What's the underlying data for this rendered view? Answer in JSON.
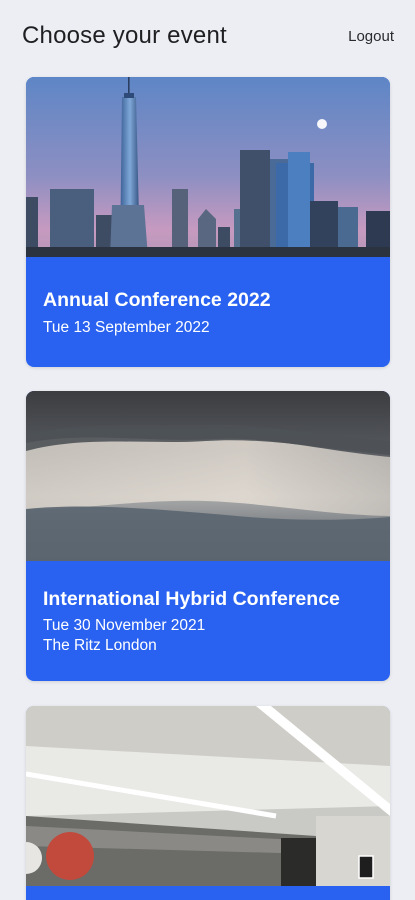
{
  "header": {
    "title": "Choose your event",
    "logout_label": "Logout"
  },
  "events": [
    {
      "title": "Annual Conference 2022",
      "date": "Tue 13 September 2022",
      "image": "city-skyline-photo"
    },
    {
      "title": "International Hybrid Conference",
      "date": "Tue 30 November 2021",
      "venue": "The Ritz London",
      "image": "cloudy-sky-photo"
    },
    {
      "image": "conference-hall-interior-photo"
    }
  ],
  "colors": {
    "background": "#eceef4",
    "card_accent": "#2962f0",
    "card_text": "#ffffff"
  }
}
